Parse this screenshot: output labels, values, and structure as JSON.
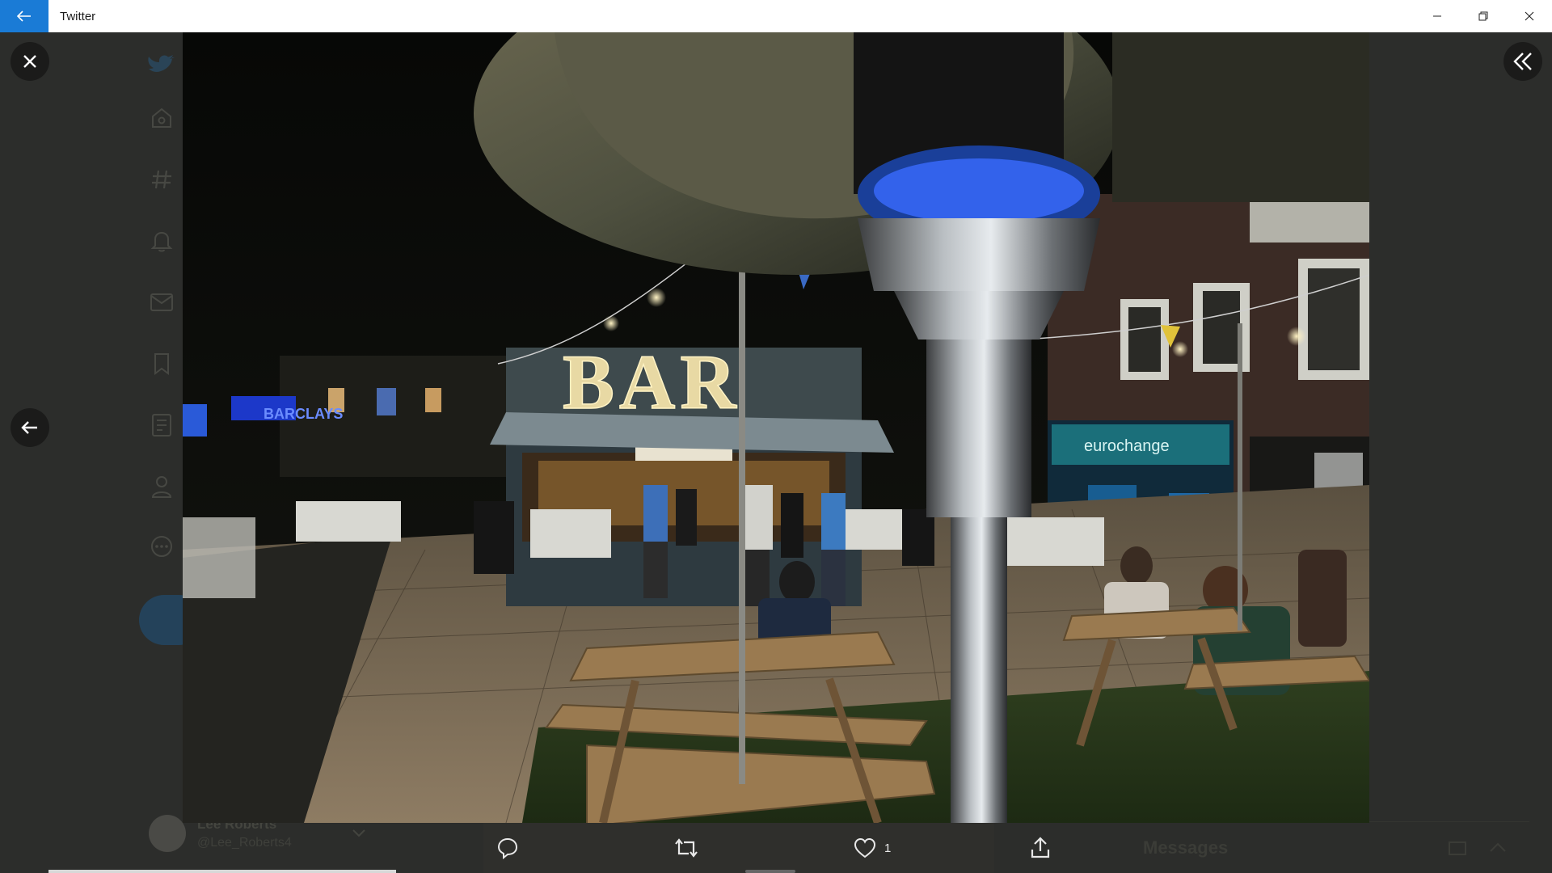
{
  "window": {
    "title": "Twitter"
  },
  "background": {
    "profile_name": "Lee Roberts",
    "profile_handle": "@Lee_Roberts4",
    "messages_title": "Messages"
  },
  "photo": {
    "sign_bar": "BAR",
    "sign_bank": "BARCLAYS",
    "sign_exchange": "eurochange"
  },
  "actions": {
    "reply_count": "",
    "retweet_count": "",
    "like_count": "1"
  },
  "colors": {
    "accent": "#1a7bd6",
    "overlay": "#2b2c2a"
  }
}
